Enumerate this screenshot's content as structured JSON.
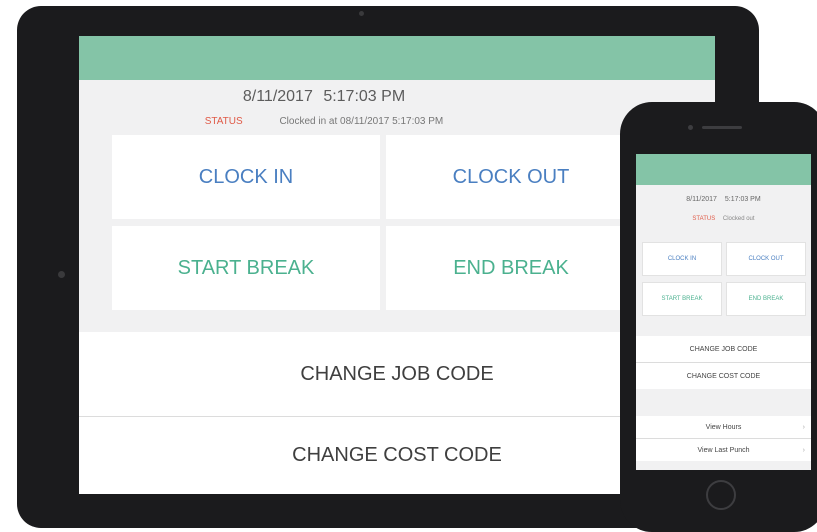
{
  "tablet": {
    "date": "8/11/2017",
    "time": "5:17:03 PM",
    "status_label": "STATUS",
    "status_text": "Clocked in at 08/11/2017 5:17:03 PM",
    "buttons": {
      "clock_in": "CLOCK IN",
      "clock_out": "CLOCK OUT",
      "start_break": "START BREAK",
      "end_break": "END BREAK"
    },
    "change_job_code": "CHANGE JOB CODE",
    "change_cost_code": "CHANGE COST CODE"
  },
  "phone": {
    "date": "8/11/2017",
    "time": "5:17:03 PM",
    "status_label": "STATUS",
    "status_text": "Clocked out",
    "buttons": {
      "clock_in": "CLOCK IN",
      "clock_out": "CLOCK OUT",
      "start_break": "START BREAK",
      "end_break": "END BREAK"
    },
    "change_job_code": "CHANGE JOB CODE",
    "change_cost_code": "CHANGE COST CODE",
    "view_hours": "View Hours",
    "view_last_punch": "View Last Punch",
    "chevron": "›"
  },
  "colors": {
    "header": "#84c4a7",
    "blue_text": "#4a7fc1",
    "green_text": "#4bb18f",
    "status_label": "#e05a47"
  }
}
